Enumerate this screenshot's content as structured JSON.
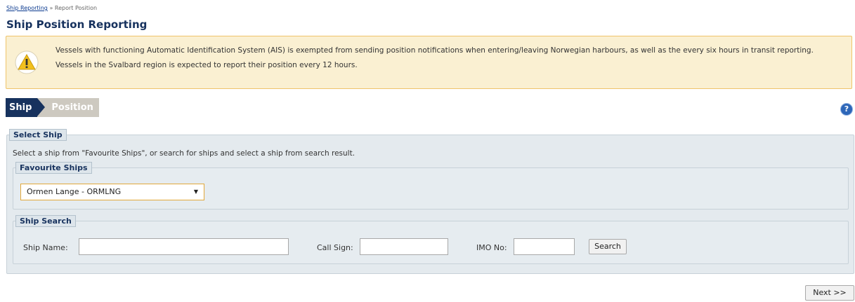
{
  "breadcrumb": {
    "link": "Ship Reporting",
    "separator": "»",
    "current": "Report Position"
  },
  "page_title": "Ship Position Reporting",
  "notice": {
    "line1": "Vessels with functioning Automatic Identification System (AIS) is exempted from sending position notifications when entering/leaving Norwegian harbours, as well as the every six hours in transit reporting.",
    "line2": "Vessels in the Svalbard region is expected to report their position every 12 hours.",
    "icon": "warning-icon"
  },
  "steps": {
    "ship": "Ship",
    "position": "Position"
  },
  "help": {
    "glyph": "?",
    "icon": "help-icon"
  },
  "select_ship": {
    "legend": "Select Ship",
    "description": "Select a ship from \"Favourite Ships\", or search for ships and select a ship from search result.",
    "favourites": {
      "legend": "Favourite Ships",
      "selected": "Ormen Lange - ORMLNG"
    },
    "search": {
      "legend": "Ship Search",
      "ship_name_label": "Ship Name:",
      "call_sign_label": "Call Sign:",
      "imo_label": "IMO No:",
      "button": "Search",
      "ship_name_value": "",
      "call_sign_value": "",
      "imo_value": ""
    }
  },
  "next_button": "Next >>",
  "colors": {
    "accent": "#17325e",
    "notice_bg": "#faf0d2",
    "notice_border": "#efc46a",
    "panel_bg": "#e4eaee"
  }
}
